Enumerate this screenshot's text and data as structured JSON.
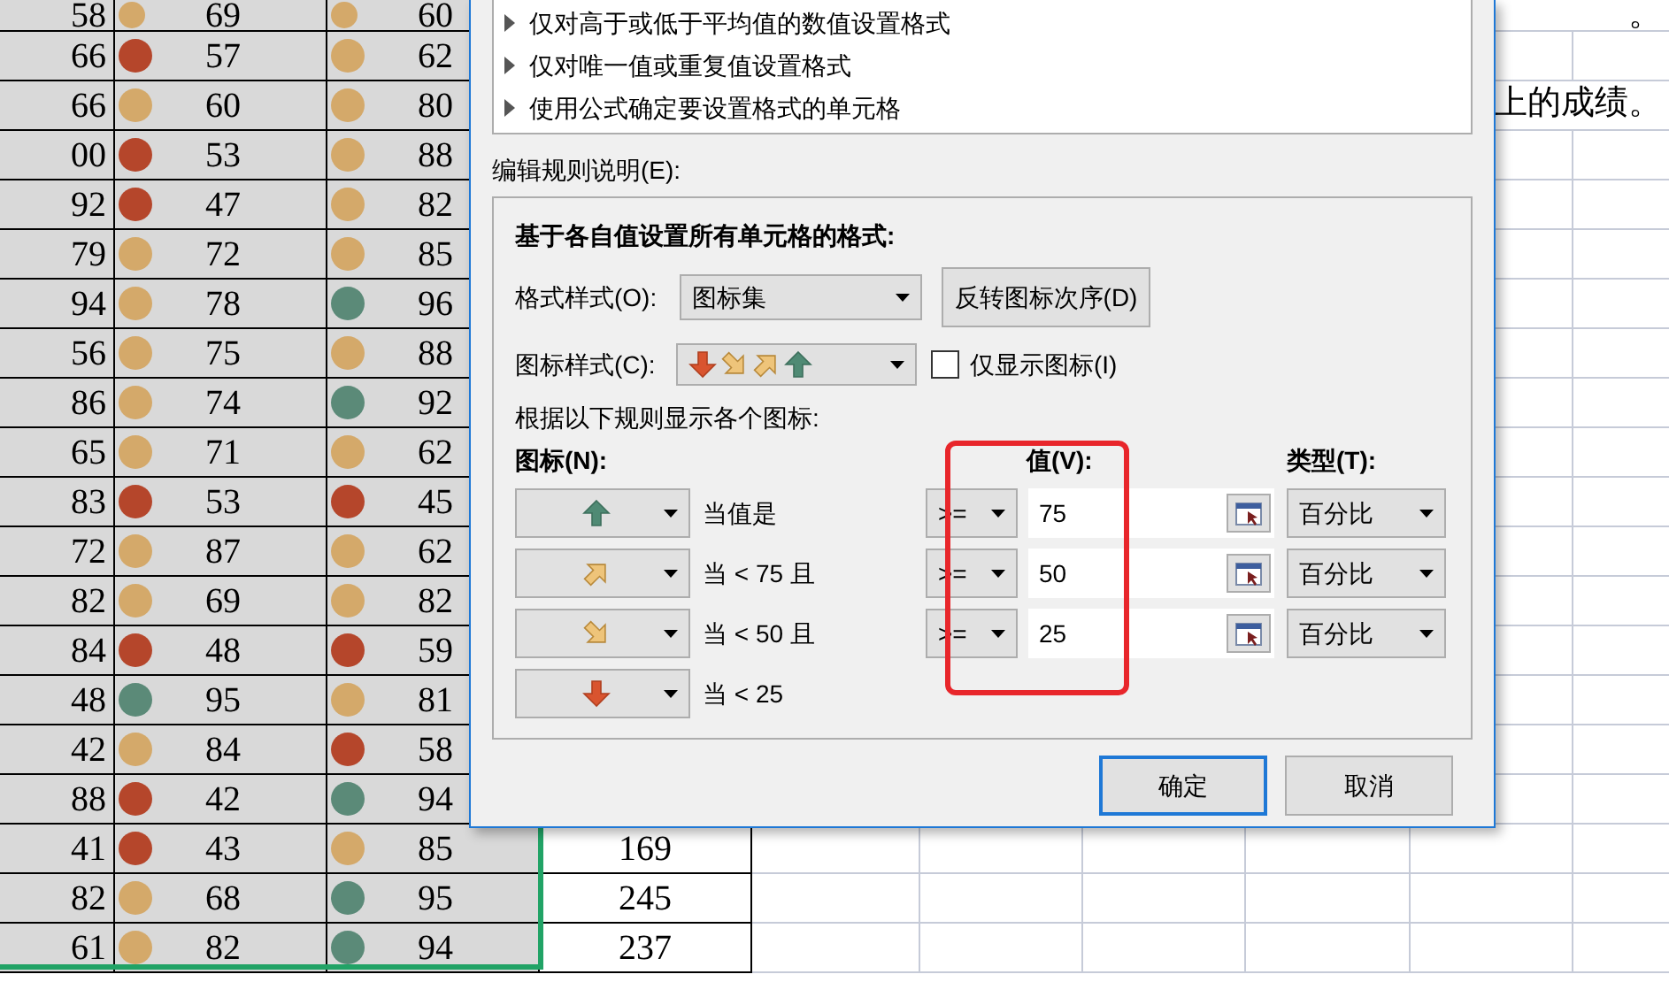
{
  "sheet": {
    "rows": [
      {
        "a": "58",
        "b": {
          "value": "69",
          "color": "#d4a96a"
        },
        "c": {
          "value": "60",
          "color": "#d4a96a"
        },
        "note": "。"
      },
      {
        "a": "66",
        "b": {
          "value": "57",
          "color": "#b5462b"
        },
        "c": {
          "value": "62",
          "color": "#d4a96a"
        }
      },
      {
        "a": "66",
        "b": {
          "value": "60",
          "color": "#d4a96a"
        },
        "c": {
          "value": "80",
          "color": "#d4a96a"
        },
        "note": "上的成绩。"
      },
      {
        "a": "00",
        "b": {
          "value": "53",
          "color": "#b5462b"
        },
        "c": {
          "value": "88",
          "color": "#d4a96a"
        }
      },
      {
        "a": "92",
        "b": {
          "value": "47",
          "color": "#b5462b"
        },
        "c": {
          "value": "82",
          "color": "#d4a96a"
        }
      },
      {
        "a": "79",
        "b": {
          "value": "72",
          "color": "#d4a96a"
        },
        "c": {
          "value": "85",
          "color": "#d4a96a"
        }
      },
      {
        "a": "94",
        "b": {
          "value": "78",
          "color": "#d4a96a"
        },
        "c": {
          "value": "96",
          "color": "#5b8a78"
        }
      },
      {
        "a": "56",
        "b": {
          "value": "75",
          "color": "#d4a96a"
        },
        "c": {
          "value": "88",
          "color": "#d4a96a"
        }
      },
      {
        "a": "86",
        "b": {
          "value": "74",
          "color": "#d4a96a"
        },
        "c": {
          "value": "92",
          "color": "#5b8a78"
        }
      },
      {
        "a": "65",
        "b": {
          "value": "71",
          "color": "#d4a96a"
        },
        "c": {
          "value": "62",
          "color": "#d4a96a"
        }
      },
      {
        "a": "83",
        "b": {
          "value": "53",
          "color": "#b5462b"
        },
        "c": {
          "value": "45",
          "color": "#b5462b"
        }
      },
      {
        "a": "72",
        "b": {
          "value": "87",
          "color": "#d4a96a"
        },
        "c": {
          "value": "62",
          "color": "#d4a96a"
        }
      },
      {
        "a": "82",
        "b": {
          "value": "69",
          "color": "#d4a96a"
        },
        "c": {
          "value": "82",
          "color": "#d4a96a"
        }
      },
      {
        "a": "84",
        "b": {
          "value": "48",
          "color": "#b5462b"
        },
        "c": {
          "value": "59",
          "color": "#b5462b"
        }
      },
      {
        "a": "48",
        "b": {
          "value": "95",
          "color": "#5b8a78"
        },
        "c": {
          "value": "81",
          "color": "#d4a96a"
        }
      },
      {
        "a": "42",
        "b": {
          "value": "84",
          "color": "#d4a96a"
        },
        "c": {
          "value": "58",
          "color": "#b5462b"
        }
      },
      {
        "a": "88",
        "b": {
          "value": "42",
          "color": "#b5462b"
        },
        "c": {
          "value": "94",
          "color": "#5b8a78"
        }
      },
      {
        "a": "41",
        "b": {
          "value": "43",
          "color": "#b5462b"
        },
        "c": {
          "value": "85",
          "color": "#d4a96a"
        },
        "d": "169"
      },
      {
        "a": "82",
        "b": {
          "value": "68",
          "color": "#d4a96a"
        },
        "c": {
          "value": "95",
          "color": "#5b8a78"
        },
        "d": "245"
      },
      {
        "a": "61",
        "b": {
          "value": "82",
          "color": "#d4a96a"
        },
        "c": {
          "value": "94",
          "color": "#5b8a78"
        },
        "d": "237"
      }
    ]
  },
  "dialog": {
    "rule_types": [
      "仅对高于或低于平均值的数值设置格式",
      "仅对唯一值或重复值设置格式",
      "使用公式确定要设置格式的单元格"
    ],
    "description_label": "编辑规则说明(E):",
    "heading": "基于各自值设置所有单元格的格式:",
    "format_style": {
      "label": "格式样式(O):",
      "value": "图标集"
    },
    "reverse_button": "反转图标次序(D)",
    "icon_style": {
      "label": "图标样式(C):"
    },
    "show_icon_only": {
      "label": "仅显示图标(I)",
      "checked": false
    },
    "rules_caption": "根据以下规则显示各个图标:",
    "columns": {
      "icon": "图标(N):",
      "value": "值(V):",
      "type": "类型(T):"
    },
    "rules": [
      {
        "condition": "当值是",
        "operator": ">=",
        "value": "75",
        "type": "百分比"
      },
      {
        "condition": "当 < 75 且",
        "operator": ">=",
        "value": "50",
        "type": "百分比"
      },
      {
        "condition": "当 < 50 且",
        "operator": ">=",
        "value": "25",
        "type": "百分比"
      },
      {
        "condition": "当 < 25"
      }
    ],
    "buttons": [
      {
        "label": "确定",
        "default": true
      },
      {
        "label": "取消",
        "default": false
      }
    ]
  }
}
